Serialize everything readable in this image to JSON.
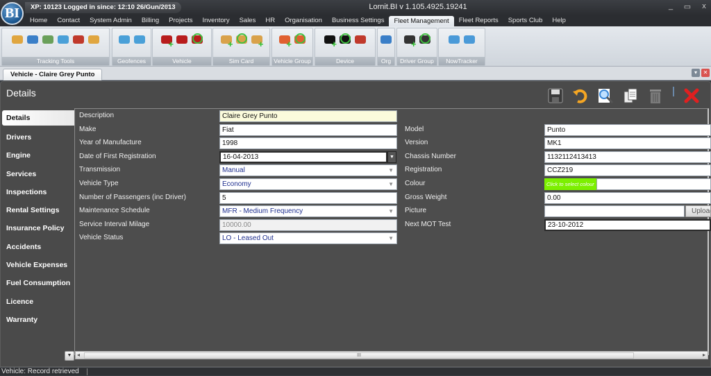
{
  "titlebar": {
    "logo": "BI",
    "session": "XP: 10123  Logged in since: 12:10 26/Gun/2013",
    "app_title": "Lornit.BI v 1.105.4925.19241",
    "minimize": "_",
    "maximize": "▭",
    "close": "x"
  },
  "menu": {
    "items": [
      {
        "label": "Home"
      },
      {
        "label": "Contact"
      },
      {
        "label": "System Admin"
      },
      {
        "label": "Billing"
      },
      {
        "label": "Projects"
      },
      {
        "label": "Inventory"
      },
      {
        "label": "Sales"
      },
      {
        "label": "HR"
      },
      {
        "label": "Organisation"
      },
      {
        "label": "Business Settings"
      },
      {
        "label": "Fleet Management",
        "active": true
      },
      {
        "label": "Fleet Reports"
      },
      {
        "label": "Sports Club"
      },
      {
        "label": "Help"
      }
    ]
  },
  "ribbon": {
    "groups": [
      {
        "label": "Tracking Tools",
        "icons": [
          "map-pin-icon",
          "gps-device-icon",
          "map-search-icon",
          "layers-map-icon",
          "tools-icon",
          "map-pin-icon"
        ]
      },
      {
        "label": "Geofences",
        "icons": [
          "geofence-map-icon",
          "geofence-map-icon"
        ]
      },
      {
        "label": "Vehicle",
        "icons": [
          "add-vehicle-icon",
          "edit-vehicle-icon",
          "search-vehicle-icon"
        ]
      },
      {
        "label": "Sim Card",
        "icons": [
          "add-sim-icon",
          "search-sim-icon",
          "add-sim-icon"
        ]
      },
      {
        "label": "Vehicle Group",
        "icons": [
          "add-vehicle-group-icon",
          "search-vehicle-group-icon"
        ]
      },
      {
        "label": "Device",
        "icons": [
          "add-device-icon",
          "search-device-icon",
          "device-tools-icon"
        ]
      },
      {
        "label": "Org",
        "icons": [
          "org-building-icon"
        ]
      },
      {
        "label": "Driver Group",
        "icons": [
          "add-driver-icon",
          "search-driver-icon"
        ]
      },
      {
        "label": "NowTracker",
        "icons": [
          "gears-icon",
          "gears-icon"
        ]
      }
    ]
  },
  "doc_tab": {
    "label": "Vehicle - Claire Grey Punto"
  },
  "panel": {
    "title": "Details",
    "toolbar": [
      {
        "name": "save-icon",
        "glyph": "💾"
      },
      {
        "name": "undo-icon",
        "glyph": "↶"
      },
      {
        "name": "search-icon",
        "glyph": "🔍"
      },
      {
        "name": "copy-icon",
        "glyph": "📄"
      },
      {
        "name": "delete-icon",
        "glyph": "🗑"
      },
      {
        "name": "close-icon",
        "glyph": "✖"
      }
    ]
  },
  "sidenav": {
    "items": [
      {
        "label": "Details",
        "active": true
      },
      {
        "label": "Drivers"
      },
      {
        "label": "Engine"
      },
      {
        "label": "Services"
      },
      {
        "label": "Inspections"
      },
      {
        "label": "Rental Settings"
      },
      {
        "label": "Insurance Policy"
      },
      {
        "label": "Accidents"
      },
      {
        "label": "Vehicle Expenses"
      },
      {
        "label": "Fuel Consumption"
      },
      {
        "label": "Licence"
      },
      {
        "label": "Warranty"
      }
    ]
  },
  "form": {
    "left": [
      {
        "label": "Description",
        "value": "Claire Grey Punto",
        "type": "text-highlight"
      },
      {
        "label": "Make",
        "value": "Fiat",
        "type": "text"
      },
      {
        "label": "Year of Manufacture",
        "value": "1998",
        "type": "text"
      },
      {
        "label": "Date of First Registration",
        "value": "16-04-2013",
        "type": "date"
      },
      {
        "label": "Transmission",
        "value": "Manual",
        "type": "select"
      },
      {
        "label": "Vehicle Type",
        "value": "Economy",
        "type": "select"
      },
      {
        "label": "Number of Passengers (inc Driver)",
        "value": "5",
        "type": "text"
      },
      {
        "label": "Maintenance Schedule",
        "value": "MFR - Medium Frequency",
        "type": "select"
      },
      {
        "label": "Service Interval Milage",
        "value": "10000.00",
        "type": "disabled"
      },
      {
        "label": "Vehicle Status",
        "value": "LO - Leased Out",
        "type": "select"
      }
    ],
    "right": [
      {
        "label": "Model",
        "value": "Punto",
        "type": "text"
      },
      {
        "label": "Version",
        "value": "MK1",
        "type": "text"
      },
      {
        "label": "Chassis Number",
        "value": "1132112413413",
        "type": "text"
      },
      {
        "label": "Registration",
        "value": "CCZ219",
        "type": "text"
      },
      {
        "label": "Colour",
        "value": "Click to select colour",
        "type": "colour",
        "color": "#7CF000"
      },
      {
        "label": "Gross Weight",
        "value": "0.00",
        "type": "text"
      },
      {
        "label": "Picture",
        "value": "",
        "type": "upload",
        "button": "Upload"
      },
      {
        "label": "Next MOT Test",
        "value": "23-10-2012",
        "type": "date-dark"
      }
    ]
  },
  "scrollbar": {
    "grip": "III",
    "left_arrow": "◂",
    "right_arrow": "▸"
  },
  "status": {
    "text": "Vehicle: Record retrieved"
  }
}
